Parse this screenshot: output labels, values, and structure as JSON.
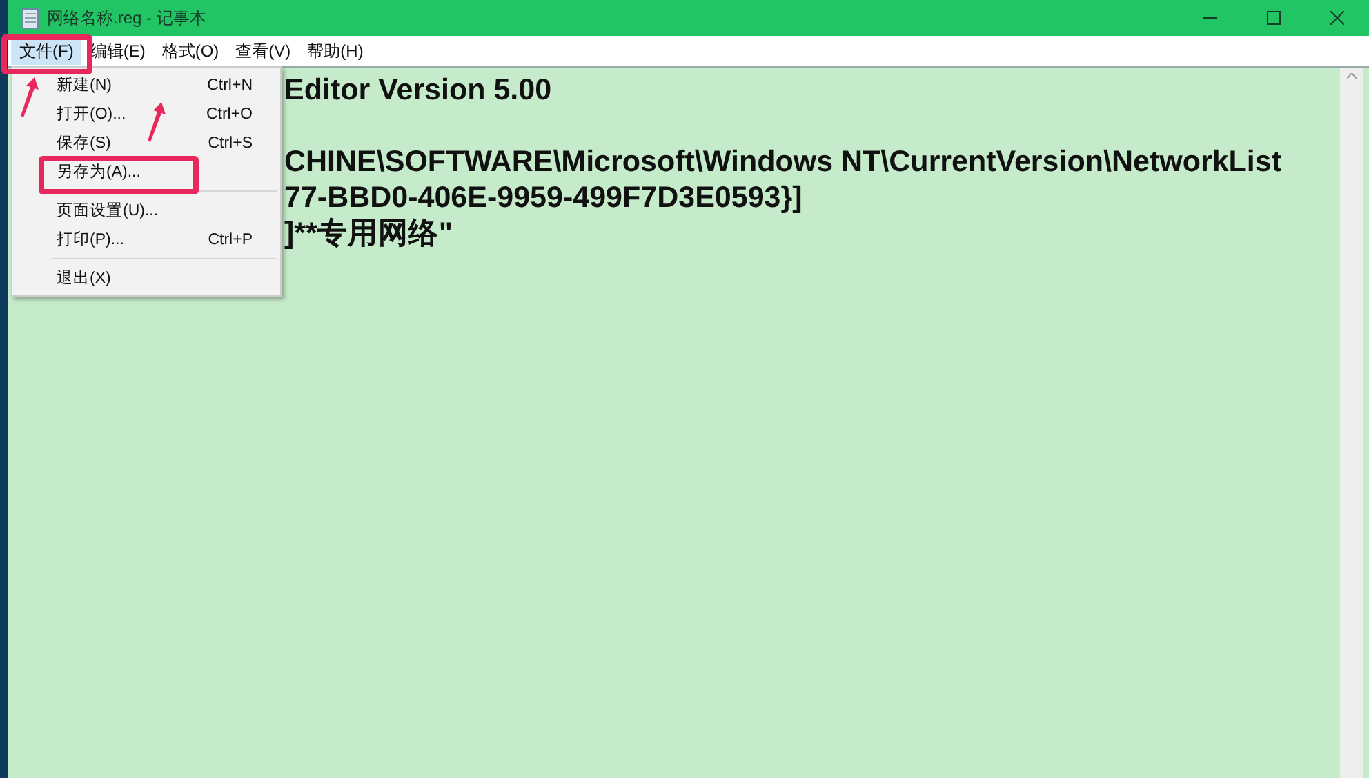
{
  "window": {
    "title": "网络名称.reg - 记事本"
  },
  "menu_bar": [
    {
      "label": "文件(F)",
      "selected": true
    },
    {
      "label": "编辑(E)",
      "selected": false
    },
    {
      "label": "格式(O)",
      "selected": false
    },
    {
      "label": "查看(V)",
      "selected": false
    },
    {
      "label": "帮助(H)",
      "selected": false
    }
  ],
  "file_menu": {
    "groups": [
      [
        {
          "label": "新建(N)",
          "shortcut": "Ctrl+N"
        },
        {
          "label": "打开(O)...",
          "shortcut": "Ctrl+O"
        },
        {
          "label": "保存(S)",
          "shortcut": "Ctrl+S"
        },
        {
          "label": "另存为(A)..."
        }
      ],
      [
        {
          "label": "页面设置(U)..."
        },
        {
          "label": "打印(P)...",
          "shortcut": "Ctrl+P"
        }
      ],
      [
        {
          "label": "退出(X)"
        }
      ]
    ]
  },
  "editor": {
    "paragraphs": [
      [
        "Editor Version 5.00"
      ],
      [
        "CHINE\\SOFTWARE\\Microsoft\\Windows NT\\CurrentVersion\\NetworkList",
        "77-BBD0-406E-9959-499F7D3E0593}]",
        "]**专用网络\""
      ]
    ]
  }
}
